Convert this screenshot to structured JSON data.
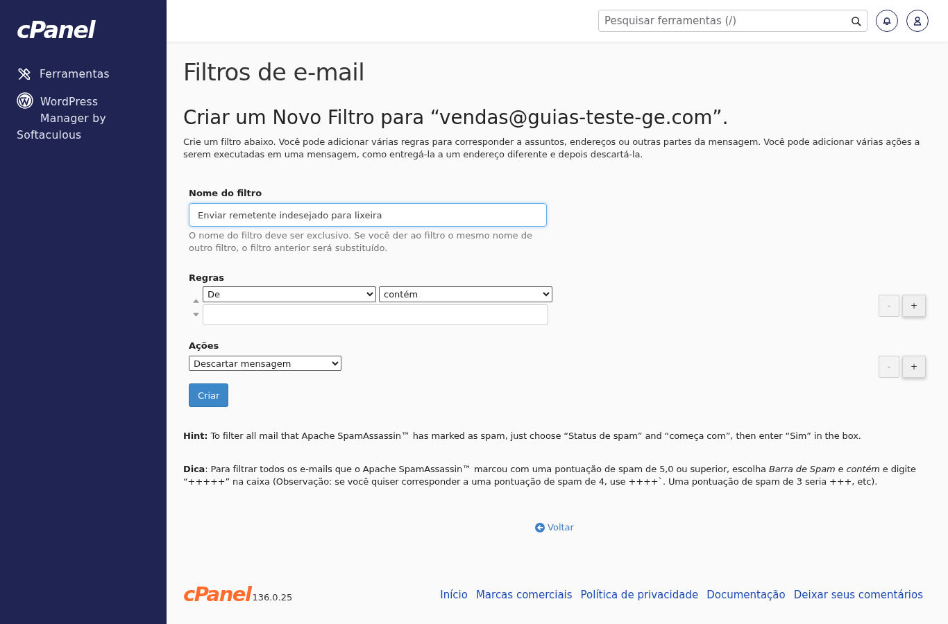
{
  "sidebar": {
    "logo": "cPanel",
    "items": [
      {
        "label": "Ferramentas"
      },
      {
        "label": "WordPress Manager by Softaculous"
      }
    ]
  },
  "topbar": {
    "search": {
      "placeholder": "Pesquisar ferramentas (/)"
    }
  },
  "page": {
    "title": "Filtros de e-mail",
    "heading": "Criar um Novo Filtro para “vendas@guias-teste-ge.com”.",
    "intro": "Crie um filtro abaixo. Você pode adicionar várias regras para corresponder a assuntos, endereços ou outras partes da mensagem. Você pode adicionar várias ações a serem executadas em uma mensagem, como entregá-la a um endereço diferente e depois descartá-la."
  },
  "filter_name": {
    "label": "Nome do filtro",
    "value": "Enviar remetente indesejado para lixeira",
    "help": "O nome do filtro deve ser exclusivo. Se você der ao filtro o mesmo nome de outro filtro, o filtro anterior será substituído."
  },
  "rules": {
    "label": "Regras",
    "rows": [
      {
        "field": "De",
        "operator": "contém"
      }
    ],
    "buttons": [
      {
        "label": "-",
        "disabled": true
      },
      {
        "label": "+",
        "disabled": false
      }
    ]
  },
  "actions": {
    "label": "Ações",
    "rows": [
      {
        "action": "Descartar mensagem"
      }
    ],
    "buttons": [
      {
        "label": "-",
        "disabled": true
      },
      {
        "label": "+",
        "disabled": false
      }
    ]
  },
  "submit": {
    "label": "Criar"
  },
  "notes": [
    "**Hint:** To filter all mail that Apache SpamAssassin™ has marked as spam, just choose “Status de spam” and “começa com”, then enter “Sim” in the box.",
    "**Dica**: Para filtrar todos os e-mails que o Apache SpamAssassin™ marcou com uma pontuação de spam de 5,0 ou superior, escolha *Barra de Spam* e *contém* e digite “+++++” na caixa (Observação: se você quiser corresponder a uma pontuação de spam de 4, use ++++`. Uma pontuação de spam de 3 seria +++, etc)."
  ],
  "back_link": {
    "label": "Voltar"
  },
  "footer": {
    "logo": "cPanel",
    "version": "136.0.25",
    "links": [
      "Início",
      "Marcas comerciais",
      "Política de privacidade",
      "Documentação",
      "Deixar seus comentários"
    ]
  }
}
